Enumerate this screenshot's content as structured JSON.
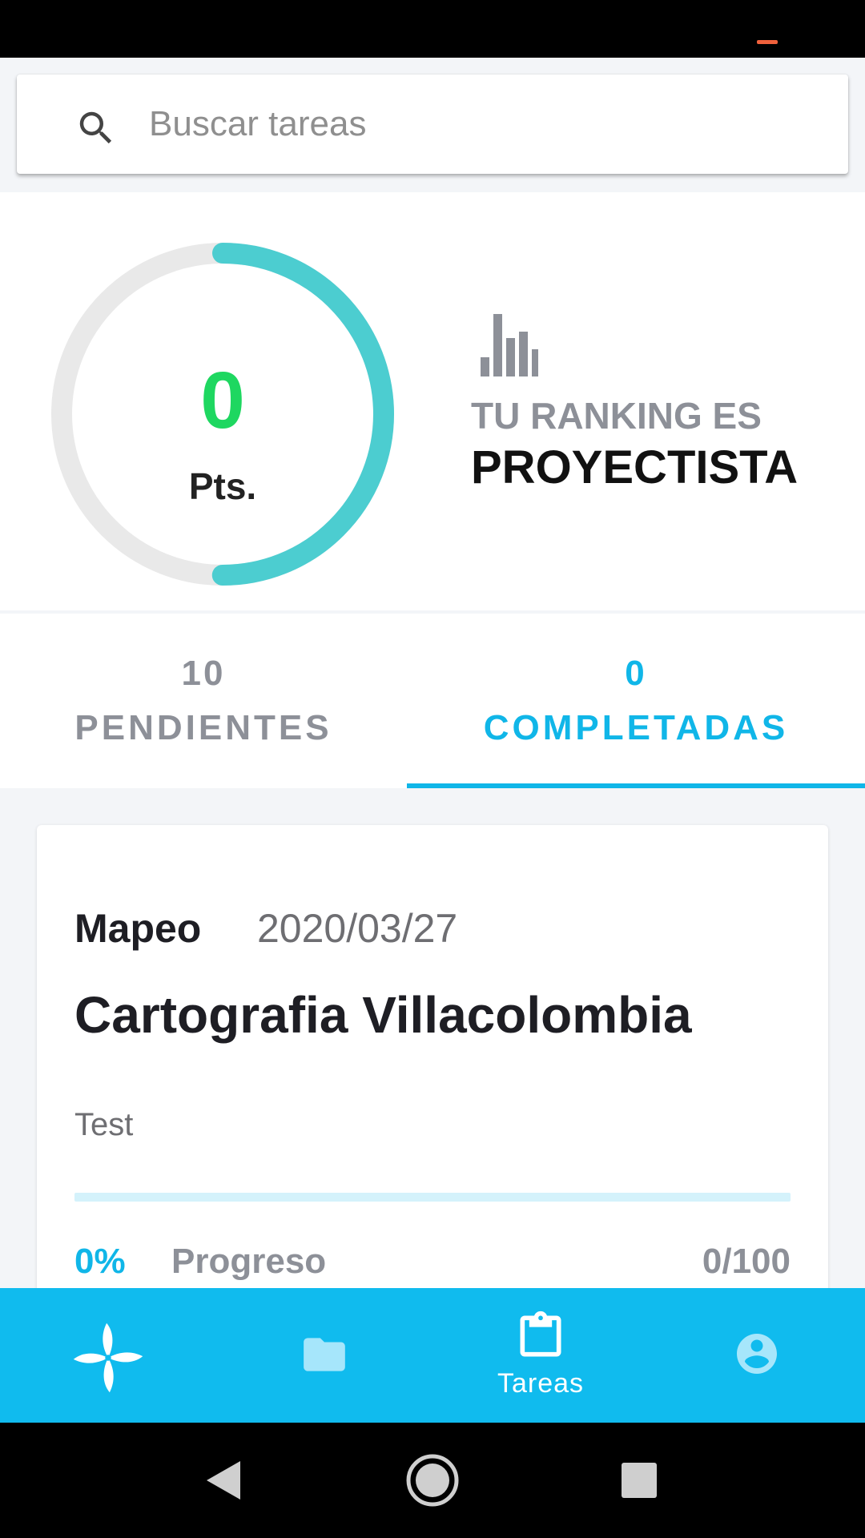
{
  "search": {
    "placeholder": "Buscar tareas",
    "icon": "search-icon"
  },
  "score": {
    "points": "0",
    "points_unit": "Pts.",
    "ring_progress": 0.5,
    "ring_color": "#4ccdd0",
    "rank_caption": "TU RANKING ES",
    "rank_title": "PROYECTISTA"
  },
  "tabs": [
    {
      "count": "10",
      "label": "PENDIENTES",
      "active": false
    },
    {
      "count": "0",
      "label": "COMPLETADAS",
      "active": true
    }
  ],
  "tasks": [
    {
      "type": "Mapeo",
      "date": "2020/03/27",
      "title": "Cartografia Villacolombia",
      "description": "Test",
      "progress_percent": "0%",
      "progress_value": 0,
      "progress_label": "Progreso",
      "progress_count": "0/100"
    }
  ],
  "bottom_nav": {
    "items": [
      {
        "icon": "pinwheel-logo-icon",
        "label": ""
      },
      {
        "icon": "folder-icon",
        "label": ""
      },
      {
        "icon": "clipboard-icon",
        "label": "Tareas",
        "active": true
      },
      {
        "icon": "account-icon",
        "label": ""
      }
    ]
  },
  "colors": {
    "accent": "#10b6e8",
    "points": "#1ed760",
    "nav_bg": "#10bbee"
  }
}
